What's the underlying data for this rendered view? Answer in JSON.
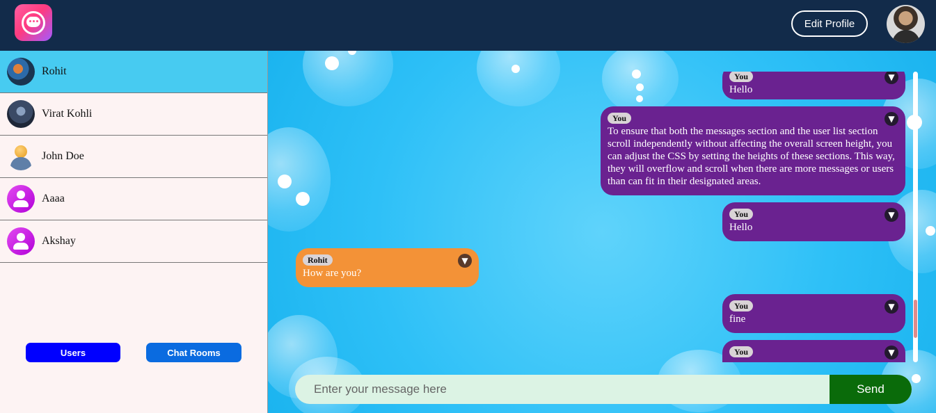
{
  "header": {
    "logo_icon": "chat-bubble-logo",
    "edit_profile_label": "Edit Profile",
    "profile_avatar_icon": "profile-avatar"
  },
  "sidebar": {
    "users": [
      {
        "name": "Rohit",
        "active": true
      },
      {
        "name": "Virat Kohli",
        "active": false
      },
      {
        "name": "John Doe",
        "active": false
      },
      {
        "name": "Aaaa",
        "active": false
      },
      {
        "name": "Akshay",
        "active": false
      }
    ],
    "users_button": "Users",
    "chat_rooms_button": "Chat Rooms"
  },
  "chat": {
    "messages": [
      {
        "sender": "You",
        "text": "Hello",
        "mine": true
      },
      {
        "sender": "You",
        "text": "To ensure that both the messages section and the user list section scroll independently without affecting the overall screen height, you can adjust the CSS by setting the heights of these sections. This way, they will overflow and scroll when there are more messages or users than can fit in their designated areas.",
        "mine": true
      },
      {
        "sender": "You",
        "text": "Hello",
        "mine": true
      },
      {
        "sender": "Rohit",
        "text": "How are you?",
        "mine": false
      },
      {
        "sender": "You",
        "text": "fine",
        "mine": true
      },
      {
        "sender": "You",
        "text": "",
        "mine": true
      }
    ],
    "caret_icon": "chevron-down-icon",
    "input_placeholder": "Enter your message here",
    "send_label": "Send"
  },
  "colors": {
    "header_bg": "#122b4a",
    "active_user_bg": "#47cbf1",
    "my_bubble": "#6a2290",
    "their_bubble": "#f39237",
    "send_button": "#0a6b0a"
  }
}
